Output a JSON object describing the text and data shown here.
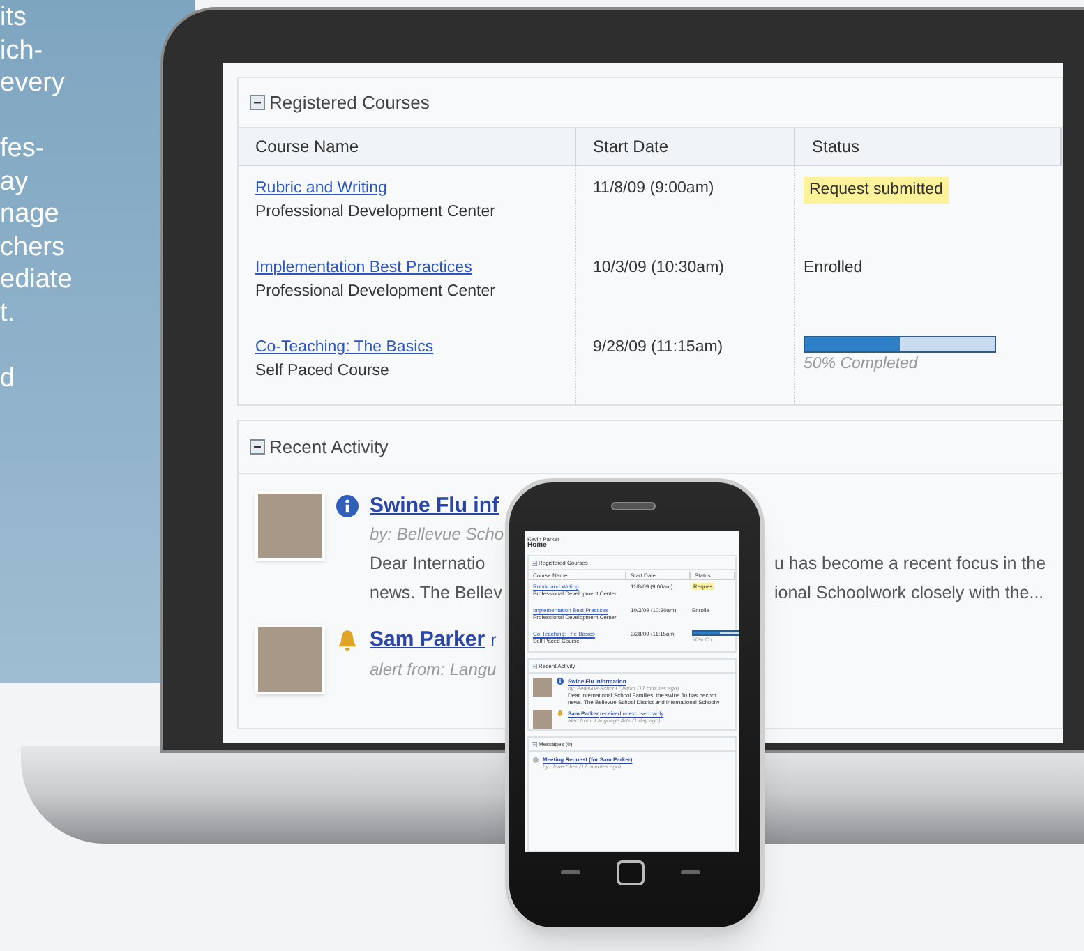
{
  "side_text": {
    "paragraphs": [
      [
        "its",
        "ich-",
        "every"
      ],
      [
        "fes-",
        "ay",
        "nage",
        "chers",
        "ediate",
        "t."
      ],
      [
        "d"
      ]
    ]
  },
  "laptop_screen": {
    "registered_courses": {
      "title": "Registered Courses",
      "columns": [
        "Course Name",
        "Start Date",
        "Status"
      ],
      "rows": [
        {
          "course": "Rubric and Writing",
          "provider": "Professional Development Center",
          "start_date": "11/8/09 (9:00am)",
          "status": {
            "kind": "badge",
            "text": "Request submitted"
          }
        },
        {
          "course": "Implementation Best Practices",
          "provider": "Professional Development Center",
          "start_date": "10/3/09 (10:30am)",
          "status": {
            "kind": "text",
            "text": "Enrolled"
          }
        },
        {
          "course": "Co-Teaching: The Basics",
          "provider": "Self Paced Course",
          "start_date": "9/28/09 (11:15am)",
          "status": {
            "kind": "progress",
            "text": "50% Completed",
            "level": 0.5
          }
        }
      ]
    },
    "recent_activity": {
      "title": "Recent Activity",
      "items": [
        {
          "kind": "info",
          "title": "Swine Flu inf",
          "byline": "by: Bellevue Scho",
          "body": [
            {
              "left": "Dear Internatio",
              "right": "u has become a recent focus in the"
            },
            {
              "left": "news. The Bellev",
              "right": "ional Schoolwork closely with the..."
            }
          ]
        },
        {
          "kind": "alert",
          "title": "Sam Parker",
          "title_rest": "r",
          "byline": "alert from: Langu"
        }
      ]
    }
  },
  "phone_screen": {
    "user": "Kevin Parker",
    "page": "Home",
    "registered_courses": {
      "title": "Registered Courses",
      "columns": [
        "Course Name",
        "Start Date",
        "Status"
      ],
      "rows": [
        {
          "course": "Rubric and Writing",
          "provider": "Professional Development Center",
          "start_date": "11/8/09 (9:00am)",
          "status": {
            "kind": "badge",
            "text": "Reques"
          }
        },
        {
          "course": "Implementation Best Practices",
          "provider": "Professional Development Center",
          "start_date": "10/3/09 (10:30am)",
          "status": {
            "kind": "text",
            "text": "Enrolle"
          }
        },
        {
          "course": "Co-Teaching: The Basics",
          "provider": "Self Paced Course",
          "start_date": "9/28/09 (11:15am)",
          "status": {
            "kind": "progress",
            "text": "50% Co",
            "level": 0.5
          }
        }
      ]
    },
    "recent_activity": {
      "title": "Recent Activity",
      "items": [
        {
          "kind": "info",
          "title": "Swine Flu information",
          "byline": "by: Bellevue School District (17 minutes ago)",
          "body": [
            "Dear International School Families, the swine flu has becom",
            "news. The Bellevue School District and International Schoolw"
          ]
        },
        {
          "kind": "alert",
          "title": "Sam Parker",
          "title_rest": "received unexcused tardy",
          "byline": "alert from: Language Arts (1 day ago)"
        }
      ]
    },
    "messages": {
      "title": "Messages (0)",
      "items": [
        {
          "title": "Meeting Request (for Sam Parker)",
          "byline": "by: Jane Cher (17 minutes ago)"
        }
      ]
    }
  }
}
